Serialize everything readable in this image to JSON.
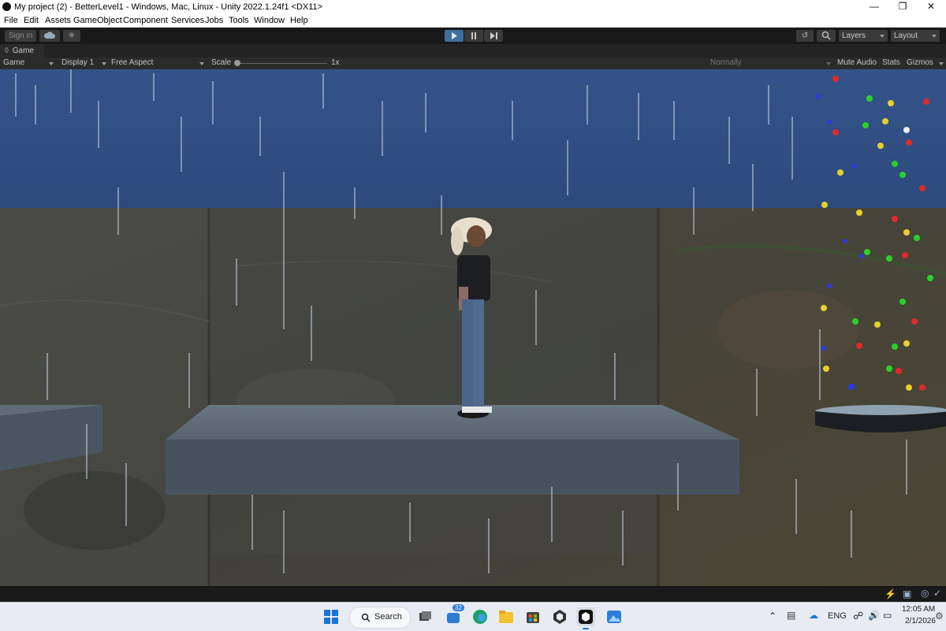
{
  "window": {
    "title": "My project (2) - BetterLevel1 - Windows, Mac, Linux - Unity 2022.1.24f1 <DX11>",
    "min_icon": "minimize-icon",
    "max_icon": "maximize-icon",
    "close_icon": "close-icon"
  },
  "menu": [
    "File",
    "Edit",
    "Assets",
    "GameObject",
    "Component",
    "Services",
    "Jobs",
    "Tools",
    "Window",
    "Help"
  ],
  "toolbar": {
    "sign_in": "Sign in",
    "cloud_icon": "cloud-icon",
    "collab_icon": "collab-icon",
    "play_icon": "play-icon",
    "pause_icon": "pause-icon",
    "step_icon": "step-icon",
    "history_icon": "history-icon",
    "search_icon": "search-icon",
    "layers": "Layers",
    "layout": "Layout"
  },
  "game_tab": {
    "label": "Game",
    "icon": "gamepad-icon",
    "view_dropdown": "Game",
    "display": "Display 1",
    "aspect": "Free Aspect",
    "scale_label": "Scale",
    "scale_value": "1x",
    "play_mode": "Normally",
    "mute": "Mute Audio",
    "stats": "Stats",
    "gizmos": "Gizmos"
  },
  "statusbar": {
    "icons": [
      "debug-icon",
      "cache-icon",
      "check-icon"
    ]
  },
  "taskbar": {
    "search": "Search",
    "badge": "32",
    "lang": "ENG",
    "time": "12:05 AM",
    "date": "2/1/2026",
    "icons": [
      "windows-start-icon",
      "search-icon",
      "task-view-icon",
      "chat-icon",
      "edge-icon",
      "file-explorer-icon",
      "store-icon",
      "unity-hub-icon",
      "unity-editor-icon",
      "photos-icon",
      "chevron-up-icon",
      "meet-icon",
      "network-icon",
      "volume-icon",
      "battery-icon"
    ]
  },
  "colors": {
    "unity_dark": "#191919",
    "panel": "#2b2b2b",
    "play_active": "#3e6f9e",
    "sky": "#2f4f82",
    "platform_top": "#5e6a78",
    "platform_side": "#47525e"
  }
}
